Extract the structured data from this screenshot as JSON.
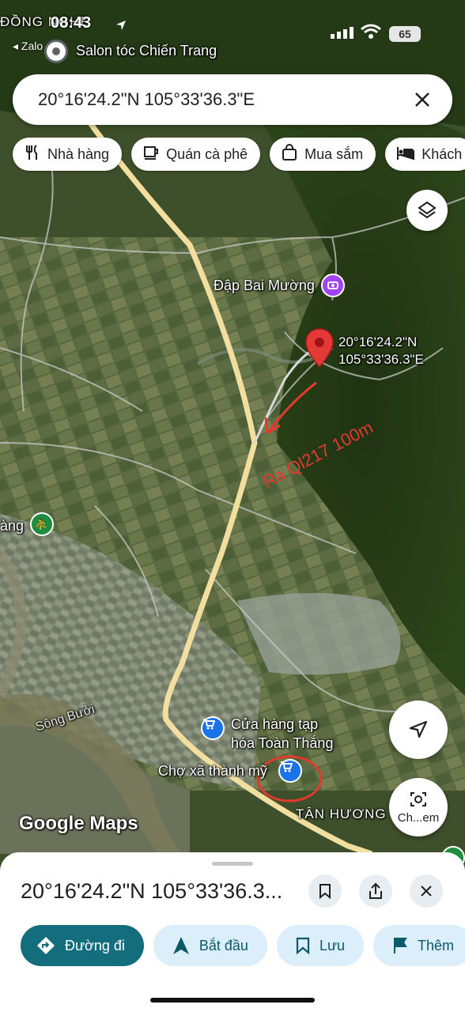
{
  "status": {
    "time": "08:43",
    "back_label": "◂ Zalo",
    "battery": "65",
    "region_label": "ĐỒNG NGHẸ"
  },
  "search": {
    "query": "20°16'24.2\"N 105°33'36.3\"E"
  },
  "chips": [
    {
      "label": "Nhà hàng",
      "icon": "fork-knife-icon"
    },
    {
      "label": "Quán cà phê",
      "icon": "coffee-cup-icon"
    },
    {
      "label": "Mua sắm",
      "icon": "shopping-bag-icon"
    },
    {
      "label": "Khách",
      "icon": "bed-icon"
    }
  ],
  "map": {
    "labels": {
      "salon": "Salon tóc Chiến Trang",
      "dam": "Đập Bai Mường",
      "pin_coords_line1": "20°16'24.2\"N",
      "pin_coords_line2": "105°33'36.3\"E",
      "annotation": "Ra Ql217 100m",
      "park_partial": "àng",
      "river": "Sông Bưởi",
      "store_line1": "Cửa hàng tạp",
      "store_line2": "hóa Toàn Thắng",
      "market": "Chợ xã thành mỹ",
      "village": "TÂN HƯƠNG",
      "watermark": "Google Maps",
      "lens_label": "Ch...em"
    },
    "colors": {
      "road": "#f2dfa0",
      "pin": "#e53935",
      "annotation": "#e23a2e",
      "poi_blue": "#1a73e8",
      "poi_purple": "#a142f4",
      "poi_green": "#1e8e3e"
    }
  },
  "sheet": {
    "title": "20°16'24.2\"N 105°33'36.3...",
    "actions": [
      {
        "label": "Đường đi",
        "icon": "directions-icon"
      },
      {
        "label": "Bắt đầu",
        "icon": "navigation-arrow-icon"
      },
      {
        "label": "Lưu",
        "icon": "bookmark-icon"
      },
      {
        "label": "Thêm",
        "icon": "flag-icon"
      }
    ]
  }
}
